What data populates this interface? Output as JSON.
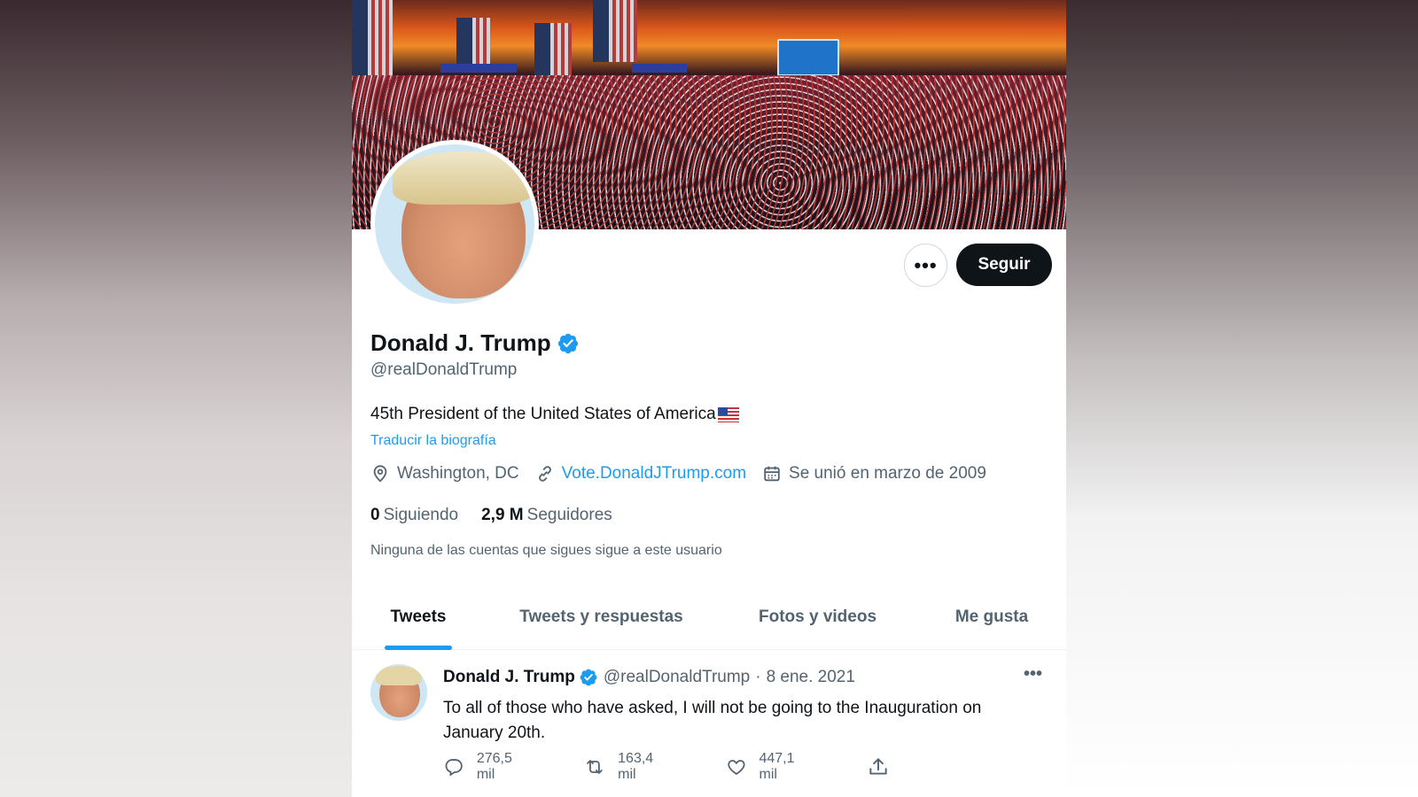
{
  "profile": {
    "name": "Donald J. Trump",
    "handle": "@realDonaldTrump",
    "bio": "45th President of the United States of America",
    "translate_bio": "Traducir la biografía",
    "location": "Washington, DC",
    "website": "Vote.DonaldJTrump.com",
    "joined": "Se unió en marzo de 2009",
    "following_count": "0",
    "following_label": "Siguiendo",
    "followers_count": "2,9 M",
    "followers_label": "Seguidores",
    "followers_note": "Ninguna de las cuentas que sigues sigue a este usuario"
  },
  "actions": {
    "more": "•••",
    "follow": "Seguir"
  },
  "tabs": [
    {
      "label": "Tweets",
      "active": true
    },
    {
      "label": "Tweets y respuestas",
      "active": false
    },
    {
      "label": "Fotos y videos",
      "active": false
    },
    {
      "label": "Me gusta",
      "active": false
    }
  ],
  "tweet": {
    "name": "Donald J. Trump",
    "handle": "@realDonaldTrump",
    "separator": "·",
    "date": "8 ene. 2021",
    "more": "•••",
    "text": "To all of those who have asked, I will not be going to the Inauguration on January 20th.",
    "replies": "276,5 mil",
    "retweets": "163,4 mil",
    "likes": "447,1 mil"
  },
  "colors": {
    "accent": "#1d9bf0",
    "text_primary": "#0f1419",
    "text_secondary": "#536471",
    "follow_button": "#0f1419"
  },
  "icons": {
    "verified": "verified-badge-icon",
    "location": "location-pin-icon",
    "link": "link-icon",
    "calendar": "calendar-icon",
    "reply": "reply-icon",
    "retweet": "retweet-icon",
    "like": "heart-icon",
    "share": "share-icon"
  }
}
